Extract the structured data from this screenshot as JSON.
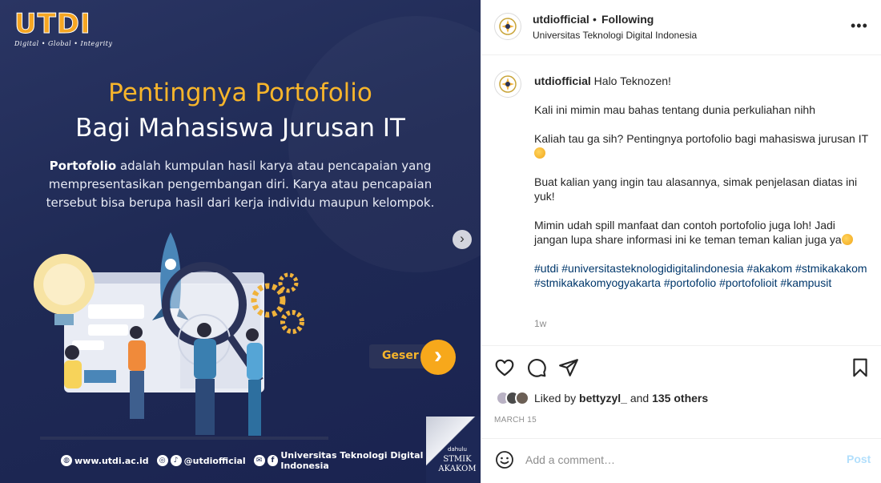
{
  "image": {
    "logo": {
      "text": "UTDI",
      "tagline": "Digital • Global • Integrity"
    },
    "headline": {
      "line1": "Pentingnya Portofolio",
      "line2": "Bagi Mahasiswa Jurusan IT"
    },
    "intro": {
      "bold": "Portofolio",
      "rest": " adalah kumpulan hasil karya atau pencapaian yang mempresentasikan pengembangan diri. Karya atau pencapaian tersebut bisa berupa hasil dari kerja individu maupun kelompok."
    },
    "geser_label": "Geser",
    "footer": {
      "website": "www.utdi.ac.id",
      "social": "@utdiofficial",
      "channel": "Universitas Teknologi Digital Indonesia"
    },
    "badge": {
      "small": "dahulu",
      "name": "STMIK AKAKOM"
    },
    "next_arrow": "›"
  },
  "header": {
    "username": "utdiofficial",
    "dot": "•",
    "following": "Following",
    "subtitle": "Universitas Teknologi Digital Indonesia",
    "more": "•••"
  },
  "caption": {
    "username": "utdiofficial",
    "greeting": " Halo Teknozen!",
    "p1": "Kali ini mimin mau bahas tentang dunia perkuliahan nihh",
    "p2": "Kaliah tau ga sih? Pentingnya portofolio bagi mahasiswa jurusan IT",
    "p3": "Buat kalian yang ingin tau alasannya, simak penjelasan diatas ini yuk!",
    "p4": "Mimin udah spill manfaat dan contoh portofolio juga loh! Jadi jangan lupa share informasi ini ke teman teman kalian juga ya",
    "hashtags": [
      "#utdi",
      "#universitasteknologidigitalindonesia",
      "#akakom",
      "#stmikakakom",
      "#stmikakakomyogyakarta",
      "#portofolio",
      "#portofolioit",
      "#kampusit"
    ],
    "time": "1w"
  },
  "likes": {
    "prefix": "Liked by ",
    "user": "bettyzyl_",
    "mid": " and ",
    "count": "135 others"
  },
  "date": "MARCH 15",
  "comment": {
    "placeholder": "Add a comment…",
    "post_label": "Post"
  }
}
